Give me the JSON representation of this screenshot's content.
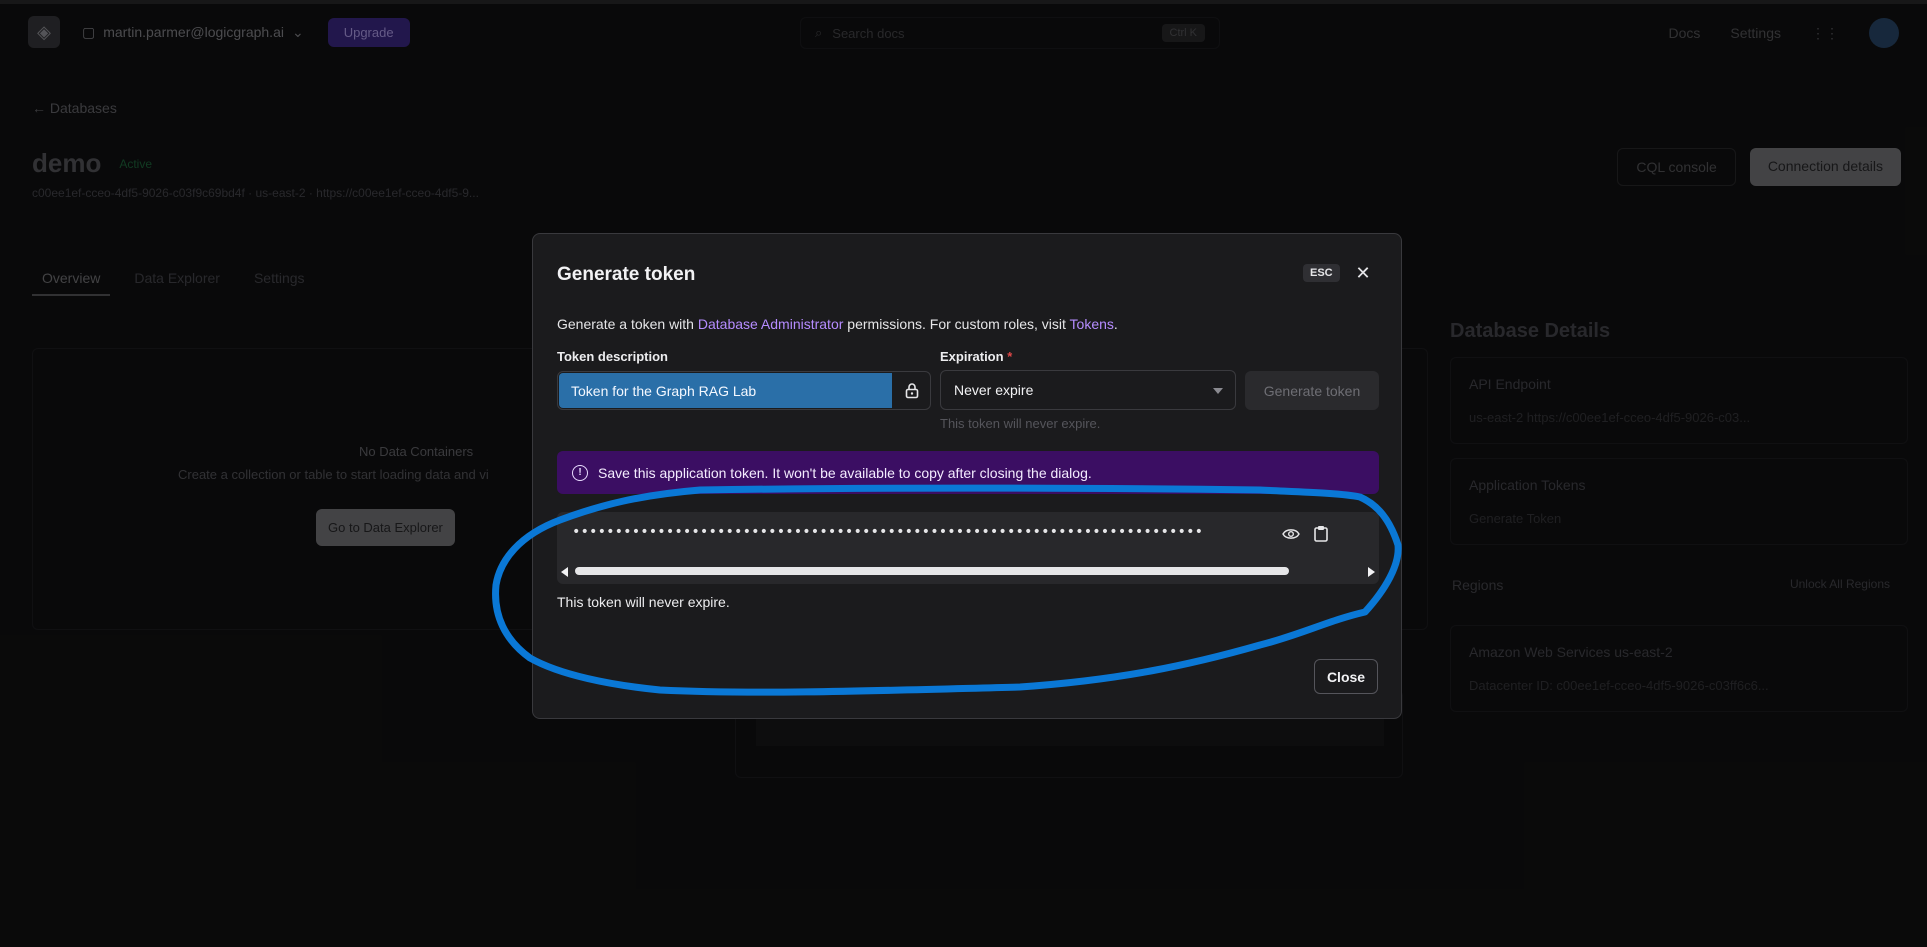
{
  "topbar": {
    "org": "martin.parmer@logicgraph.ai",
    "upgrade_label": "Upgrade",
    "search_placeholder": "Search docs",
    "search_kbd": "Ctrl K",
    "docs_label": "Docs",
    "settings_label": "Settings"
  },
  "page": {
    "back_label": "Databases",
    "db_name": "demo",
    "status": "Active",
    "meta": "c00ee1ef-cceo-4df5-9026-c03f9c69bd4f · us-east-2 · https://c00ee1ef-cceo-4df5-9...",
    "edit_button": "CQL console",
    "connect_button": "Connection details",
    "tabs": [
      "Overview",
      "Data Explorer",
      "Settings"
    ],
    "empty_title": "No Data Containers",
    "empty_sub": "Create a collection or table to start loading data and vi",
    "explorer_button": "Go to Data Explorer"
  },
  "right_col": {
    "title": "Database Details",
    "api_title": "API Endpoint",
    "api_row": "us-east-2    https://c00ee1ef-cceo-4df5-9026-c03...",
    "tokens_title": "Application Tokens",
    "tokens_row": "Generate Token",
    "regions_title": "Regions",
    "regions_link": "Unlock All Regions",
    "region_row": "Amazon Web Services    us-east-2",
    "region_sub": "Datacenter ID: c00ee1ef-cceo-4df5-9026-c03ff6c6..."
  },
  "modal": {
    "title": "Generate token",
    "esc_label": "ESC",
    "desc_prefix": "Generate a token with ",
    "desc_link1": "Database Administrator",
    "desc_middle": " permissions. For custom roles, visit ",
    "desc_link2": "Tokens",
    "desc_suffix": ".",
    "token_desc_label": "Token description",
    "token_desc_value": "Token for the Graph RAG Lab",
    "expiration_label": "Expiration",
    "expiration_required": "*",
    "expiration_value": "Never expire",
    "generate_button": "Generate token",
    "expiration_help": "This token will never expire.",
    "banner_text": "Save this application token. It won't be available to copy after closing the dialog.",
    "token_masked": "••••••••••••••••••••••••••••••••••••••••••••••••••••••••••••••••••••••••••••••••••••••••••••••••••••••",
    "expire_note": "This token will never expire.",
    "close_button": "Close"
  },
  "colors": {
    "banner": "#3b0e63",
    "link": "#b58cff",
    "selection": "#2a6fa8",
    "annotation": "#0a78d6"
  },
  "icons": [
    "eye-icon",
    "clipboard-icon",
    "lock-icon",
    "info-icon",
    "close-icon",
    "chevron-down-icon"
  ]
}
